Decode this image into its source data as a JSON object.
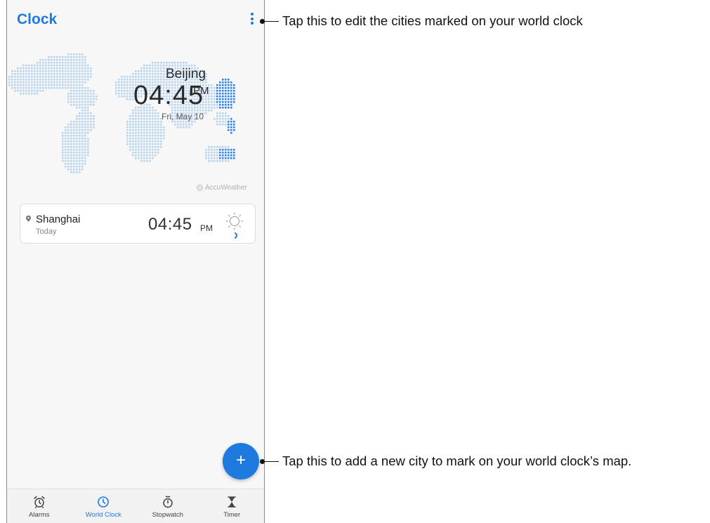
{
  "app": {
    "title": "Clock"
  },
  "map": {
    "city": "Beijing",
    "time": "04:45",
    "ampm": "PM",
    "date": "Fri, May 10",
    "attribution": "AccuWeather"
  },
  "cities": [
    {
      "name": "Shanghai",
      "day": "Today",
      "time": "04:45",
      "ampm": "PM",
      "weather": "sunny-icon"
    }
  ],
  "fab": {
    "label": "+"
  },
  "nav": {
    "items": [
      {
        "label": "Alarms",
        "icon": "alarm-icon"
      },
      {
        "label": "World Clock",
        "icon": "clock-icon",
        "active": true
      },
      {
        "label": "Stopwatch",
        "icon": "stopwatch-icon"
      },
      {
        "label": "Timer",
        "icon": "hourglass-icon"
      }
    ]
  },
  "callouts": {
    "menu": "Tap this to edit the cities marked on your world clock",
    "add": "Tap this to add a new city to mark on your world clock’s map."
  },
  "colors": {
    "accent": "#1f7ae0",
    "map_dots": "#bcd3ea",
    "map_highlight": "#3f82d8"
  }
}
